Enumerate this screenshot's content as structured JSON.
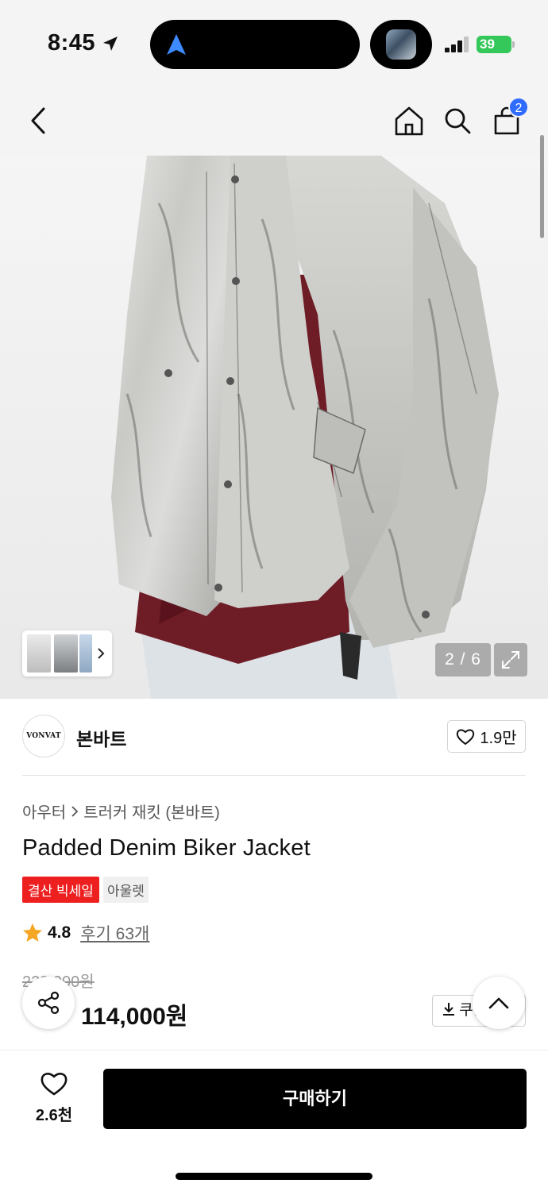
{
  "status_bar": {
    "time": "8:45",
    "battery": "39"
  },
  "header": {
    "cart_count": "2"
  },
  "gallery": {
    "counter": "2 / 6"
  },
  "brand": {
    "logo_text": "VONVAT",
    "name": "본바트",
    "likes": "1.9만"
  },
  "product": {
    "breadcrumb": [
      "아우터",
      "트러커 재킷 (본바트)"
    ],
    "title": "Padded Denim Biker Jacket",
    "badges": [
      "결산 빅세일",
      "아울렛"
    ],
    "rating": "4.8",
    "reviews": "후기 63개",
    "original_price": "228,000원",
    "price": "114,000원",
    "coupon_label": "쿠폰"
  },
  "bottom_bar": {
    "like_count": "2.6천",
    "buy_label": "구매하기"
  },
  "colors": {
    "accent_red": "#ee1f1f",
    "badge_blue": "#2f6bff",
    "battery_green": "#34c759",
    "star": "#f5a623"
  }
}
